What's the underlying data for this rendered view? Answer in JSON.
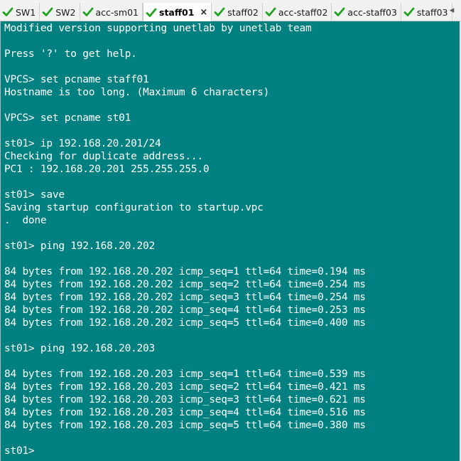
{
  "tabs": [
    {
      "label": "SW1",
      "active": false
    },
    {
      "label": "SW2",
      "active": false
    },
    {
      "label": "acc-sm01",
      "active": false
    },
    {
      "label": "staff01",
      "active": true
    },
    {
      "label": "staff02",
      "active": false
    },
    {
      "label": "acc-staff02",
      "active": false
    },
    {
      "label": "acc-staff03",
      "active": false
    },
    {
      "label": "staff03",
      "active": false
    }
  ],
  "tab_close_glyph": "×",
  "tab_scroll_glyph": "◂",
  "colors": {
    "terminal_bg": "#008080",
    "terminal_fg": "#ffffff",
    "check_green": "#1fa31f"
  },
  "terminal": {
    "lines": [
      "Modified version supporting unetlab by unetlab team",
      "",
      "Press '?' to get help.",
      "",
      "VPCS> set pcname staff01",
      "Hostname is too long. (Maximum 6 characters)",
      "",
      "VPCS> set pcname st01",
      "",
      "st01> ip 192.168.20.201/24",
      "Checking for duplicate address...",
      "PC1 : 192.168.20.201 255.255.255.0",
      "",
      "st01> save",
      "Saving startup configuration to startup.vpc",
      ".  done",
      "",
      "st01> ping 192.168.20.202",
      "",
      "84 bytes from 192.168.20.202 icmp_seq=1 ttl=64 time=0.194 ms",
      "84 bytes from 192.168.20.202 icmp_seq=2 ttl=64 time=0.254 ms",
      "84 bytes from 192.168.20.202 icmp_seq=3 ttl=64 time=0.254 ms",
      "84 bytes from 192.168.20.202 icmp_seq=4 ttl=64 time=0.253 ms",
      "84 bytes from 192.168.20.202 icmp_seq=5 ttl=64 time=0.400 ms",
      "",
      "st01> ping 192.168.20.203",
      "",
      "84 bytes from 192.168.20.203 icmp_seq=1 ttl=64 time=0.539 ms",
      "84 bytes from 192.168.20.203 icmp_seq=2 ttl=64 time=0.421 ms",
      "84 bytes from 192.168.20.203 icmp_seq=3 ttl=64 time=0.621 ms",
      "84 bytes from 192.168.20.203 icmp_seq=4 ttl=64 time=0.516 ms",
      "84 bytes from 192.168.20.203 icmp_seq=5 ttl=64 time=0.380 ms",
      "",
      "st01> "
    ]
  }
}
